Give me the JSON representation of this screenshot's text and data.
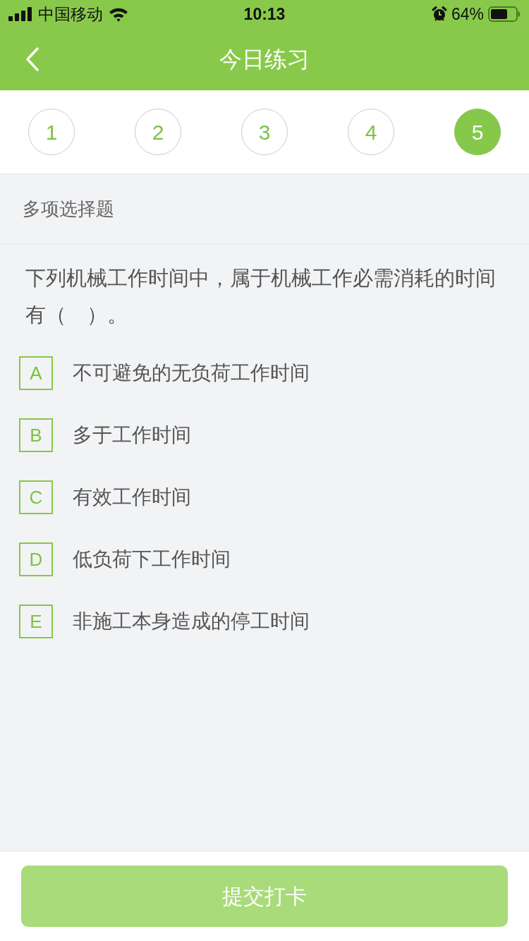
{
  "status_bar": {
    "carrier": "中国移动",
    "time": "10:13",
    "battery": "64%"
  },
  "nav_bar": {
    "title": "今日练习"
  },
  "question_tabs": [
    {
      "label": "1",
      "selected": false
    },
    {
      "label": "2",
      "selected": false
    },
    {
      "label": "3",
      "selected": false
    },
    {
      "label": "4",
      "selected": false
    },
    {
      "label": "5",
      "selected": true
    }
  ],
  "section": {
    "title": "多项选择题"
  },
  "question": {
    "text": "下列机械工作时间中，属于机械工作必需消耗的时间有（　）。",
    "options": [
      {
        "letter": "A",
        "text": "不可避免的无负荷工作时间",
        "selected": false
      },
      {
        "letter": "B",
        "text": "多于工作时间",
        "selected": false
      },
      {
        "letter": "C",
        "text": "有效工作时间",
        "selected": false
      },
      {
        "letter": "D",
        "text": "低负荷下工作时间",
        "selected": false
      },
      {
        "letter": "E",
        "text": "非施工本身造成的停工时间",
        "selected": false
      }
    ]
  },
  "submit_button": {
    "label": "提交打卡",
    "disabled": true
  }
}
